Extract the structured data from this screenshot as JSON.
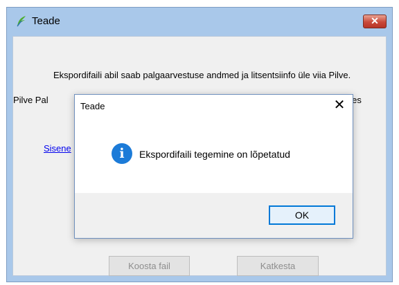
{
  "window": {
    "title": "Teade",
    "close_label": "✕",
    "message_line1": "Ekspordifaili abil saab palgaarvestuse andmed ja litsentsiinfo üle viia Pilve.",
    "message_line2_left": "Pilve Pal",
    "message_line2_right": "kkides",
    "link_text": "Sisene",
    "buttons": {
      "create_file": "Koosta fail",
      "cancel": "Katkesta"
    }
  },
  "dialog": {
    "title": "Teade",
    "close_label": "✕",
    "icon": "info-icon",
    "message": "Ekspordifaili tegemine on lõpetatud",
    "ok_label": "OK"
  },
  "colors": {
    "frame": "#a9c8ea",
    "accent": "#0078d7",
    "info_icon": "#1c7bd8"
  }
}
